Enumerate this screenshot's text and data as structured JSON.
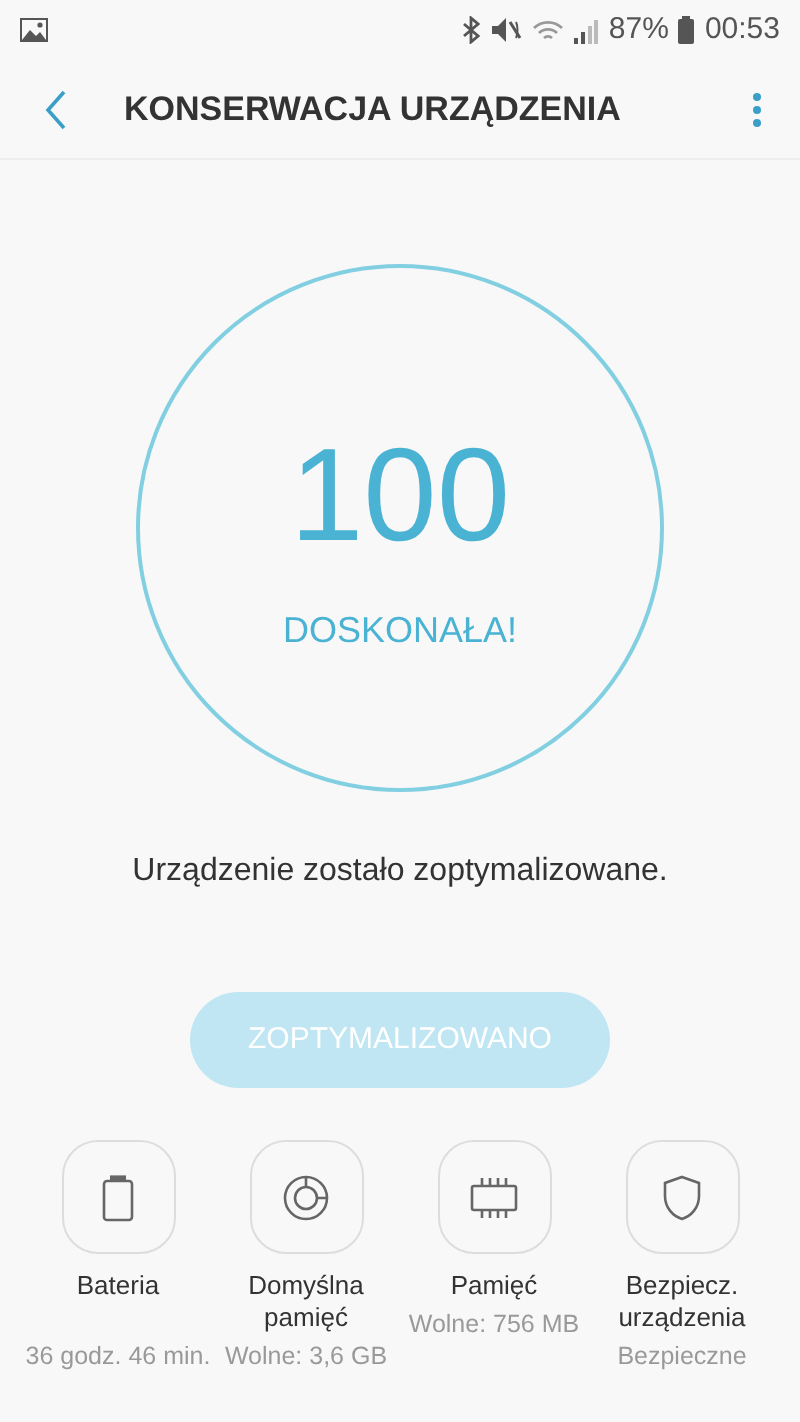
{
  "status_bar": {
    "battery": "87%",
    "time": "00:53"
  },
  "header": {
    "title": "KONSERWACJA URZĄDZENIA"
  },
  "score": {
    "value": "100",
    "rating": "DOSKONAŁA!"
  },
  "message": "Urządzenie zostało zoptymalizowane.",
  "optimize_button": {
    "label": "ZOPTYMALIZOWANO",
    "disabled": true
  },
  "tiles": [
    {
      "kind": "battery",
      "label": "Bateria",
      "detail": "36 godz. 46 min."
    },
    {
      "kind": "storage",
      "label": "Domyślna pamięć",
      "detail": "Wolne: 3,6 GB"
    },
    {
      "kind": "memory",
      "label": "Pamięć",
      "detail": "Wolne: 756 MB"
    },
    {
      "kind": "security",
      "label": "Bezpiecz. urządzenia",
      "detail": "Bezpieczne"
    }
  ]
}
